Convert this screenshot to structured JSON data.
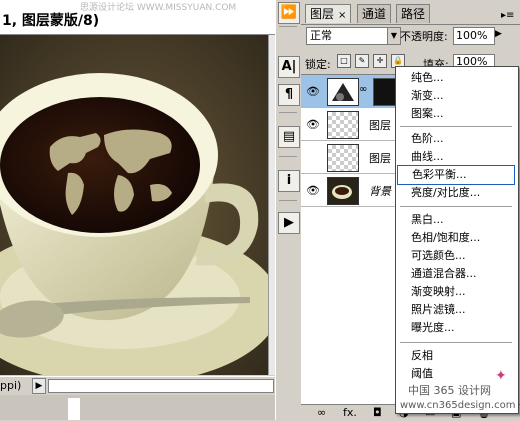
{
  "document": {
    "title": "1, 图层蒙版/8)",
    "watermark_top": "思源设计论坛 WWW.MISSYUAN.COM",
    "status_zoom": "ppi)",
    "status_arrow": "▶"
  },
  "dock": {
    "buttons": [
      "⏩",
      "A|",
      "¶",
      "▤",
      "i",
      "▶"
    ]
  },
  "layers_panel": {
    "tabs": [
      {
        "label": "图层",
        "close": "×"
      },
      {
        "label": "通道"
      },
      {
        "label": "路径"
      }
    ],
    "menu_button": "▸≡",
    "blend_mode": "正常",
    "blend_arrow": "▼",
    "opacity_label": "不透明度:",
    "opacity_value": "100%",
    "opacity_arrow": "▶",
    "lock_label": "锁定:",
    "lock_icons": [
      "□",
      "✎",
      "✛",
      "🔒"
    ],
    "fill_label": "填充:",
    "fill_value": "100%",
    "layers": [
      {
        "name": "",
        "eye": "👁",
        "selected": true
      },
      {
        "name": "图层",
        "eye": "👁"
      },
      {
        "name": "图层",
        "eye": ""
      },
      {
        "name": "背景",
        "eye": "👁",
        "italic": true
      }
    ],
    "footer_icons": [
      "∞",
      "fx.",
      "◘",
      "◑",
      "▭",
      "▣",
      "🗑"
    ]
  },
  "context_menu": {
    "groups": [
      [
        "纯色...",
        "渐变...",
        "图案..."
      ],
      [
        "色阶...",
        "曲线...",
        "色彩平衡...",
        "亮度/对比度..."
      ],
      [
        "黑白...",
        "色相/饱和度...",
        "可选颜色...",
        "通道混合器...",
        "渐变映射...",
        "照片滤镜...",
        "曝光度..."
      ],
      [
        "反相",
        "阈值"
      ]
    ],
    "highlighted": "色彩平衡..."
  },
  "watermark_bottom": {
    "cn": "中国 365 设计网",
    "url": "www.cn365design.com",
    "cursor": "✦"
  }
}
